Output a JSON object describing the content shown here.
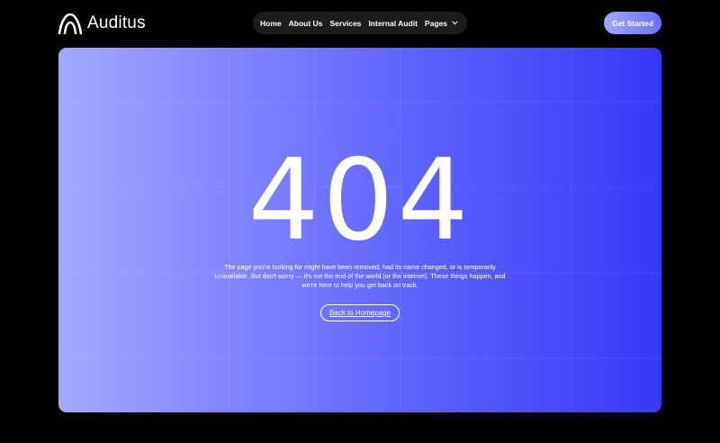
{
  "brand": {
    "name": "Auditus",
    "logo_icon": "arch-logo-icon"
  },
  "nav": {
    "items": [
      {
        "label": "Home"
      },
      {
        "label": "About Us"
      },
      {
        "label": "Services"
      },
      {
        "label": "Internal Audit"
      },
      {
        "label": "Pages",
        "icon": "chevron-down-icon"
      }
    ]
  },
  "header": {
    "cta_label": "Get Started"
  },
  "error": {
    "code": "404",
    "message": "The page you're looking for might have been removed, had its name changed, or is temporarily unavailable. But don't worry — it's not the end of the world (or the internet). These things happen, and we're here to help you get back on track.",
    "back_label": "Back to Homepage"
  },
  "colors": {
    "background": "#000000",
    "nav_bg": "#1c1c1c",
    "cta_gradient_start": "#a3a6ff",
    "cta_gradient_end": "#6a70ff",
    "hero_gradient_start": "#a5a8ff",
    "hero_gradient_end": "#3838fa"
  }
}
